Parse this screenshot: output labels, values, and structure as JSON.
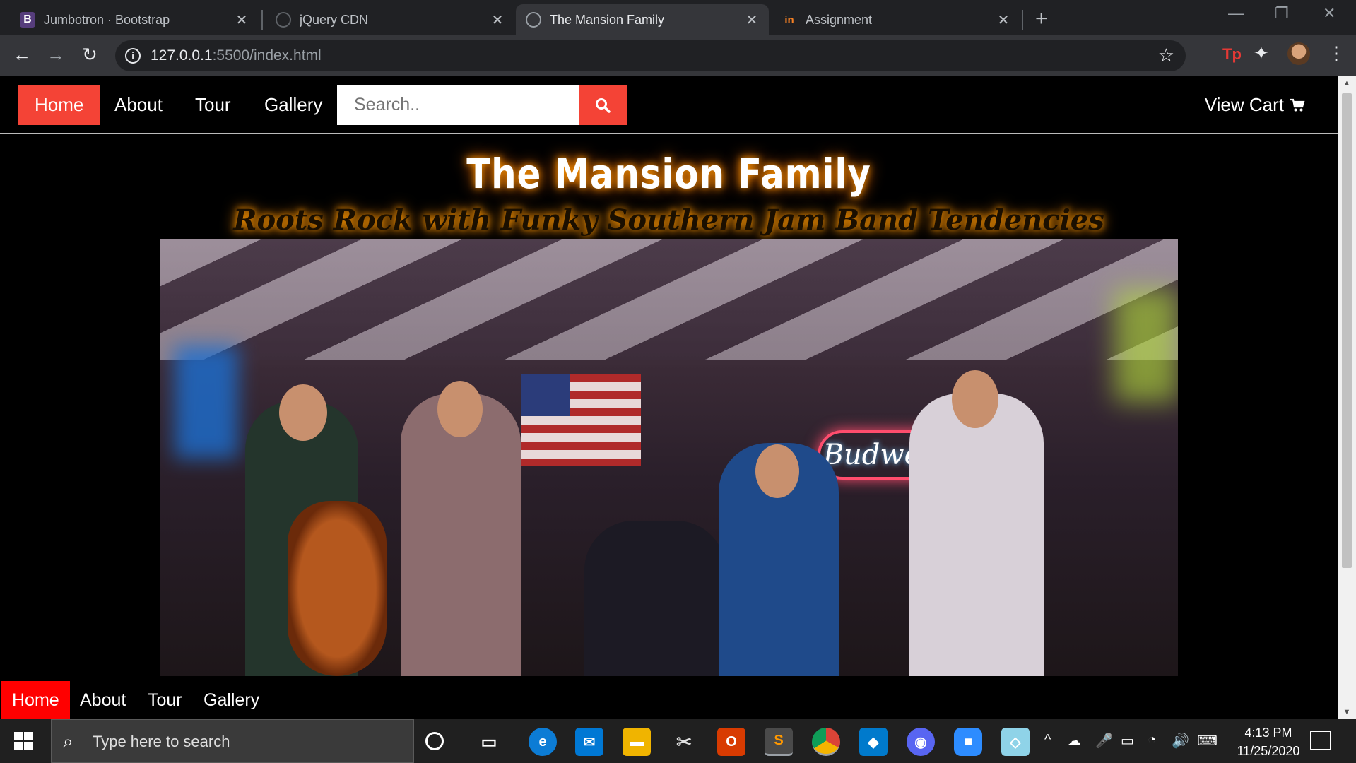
{
  "browser": {
    "tabs": [
      {
        "title": "Jumbotron · Bootstrap",
        "favicon": "B",
        "favicon_color": "#563d7c",
        "active": false
      },
      {
        "title": "jQuery CDN",
        "favicon": "globe",
        "favicon_color": "#5f6368",
        "active": false
      },
      {
        "title": "The Mansion Family",
        "favicon": "globe",
        "favicon_color": "#5f6368",
        "active": true
      },
      {
        "title": "Assignment",
        "favicon": "in",
        "favicon_color": "#f48024",
        "active": false
      }
    ],
    "url_host": "127.0.0.1",
    "url_rest": ":5500/index.html"
  },
  "site": {
    "nav": {
      "items": [
        "Home",
        "About",
        "Tour",
        "Gallery"
      ],
      "active": "Home",
      "search_placeholder": "Search..",
      "cart_label": "View Cart"
    },
    "title": "The Mansion Family",
    "tagline": "Roots Rock with Funky Southern Jam Band Tendencies",
    "hero_sign_text": "Budweiser",
    "bottom_nav": {
      "items": [
        "Home",
        "About",
        "Tour",
        "Gallery"
      ],
      "active": "Home"
    },
    "colors": {
      "accent": "#f44336",
      "glow": "#ff9800"
    }
  },
  "taskbar": {
    "search_placeholder": "Type here to search",
    "time": "4:13 PM",
    "date": "11/25/2020"
  }
}
